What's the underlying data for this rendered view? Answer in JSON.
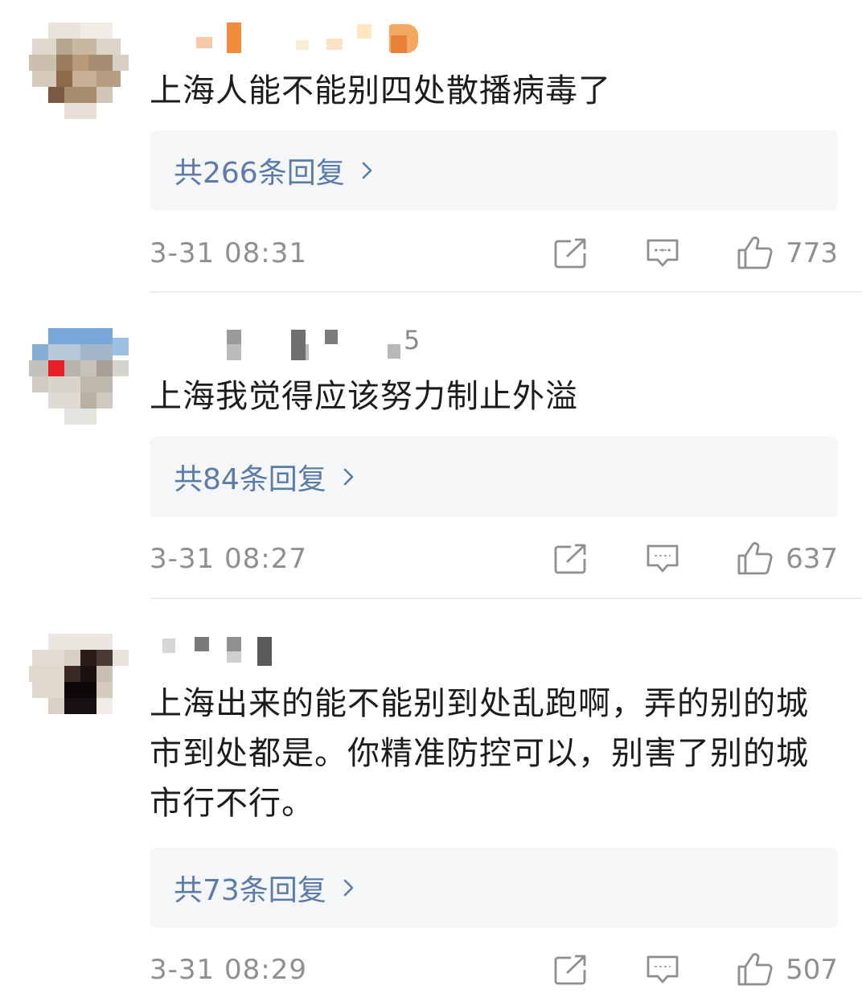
{
  "comments": [
    {
      "name_suffix": "",
      "text": "上海人能不能别四处散播病毒了",
      "replies_label": "共266条回复",
      "time": "3-31 08:31",
      "likes": "773"
    },
    {
      "name_suffix": "5",
      "text": "上海我觉得应该努力制止外溢",
      "replies_label": "共84条回复",
      "time": "3-31 08:27",
      "likes": "637"
    },
    {
      "name_suffix": "",
      "text": "上海出来的能不能别到处乱跑啊，弄的别的城市到处都是。你精准防控可以，别害了别的城市行不行。",
      "replies_label": "共73条回复",
      "time": "3-31 08:29",
      "likes": "507"
    }
  ],
  "icons": {
    "share": "share-icon",
    "comment": "comment-icon",
    "like": "thumbs-up-icon",
    "chevron": "chevron-right-icon"
  },
  "colors": {
    "reply_link": "#5b7ba8",
    "meta_text": "#8f8f8f",
    "reply_box_bg": "#f5f6f8"
  }
}
